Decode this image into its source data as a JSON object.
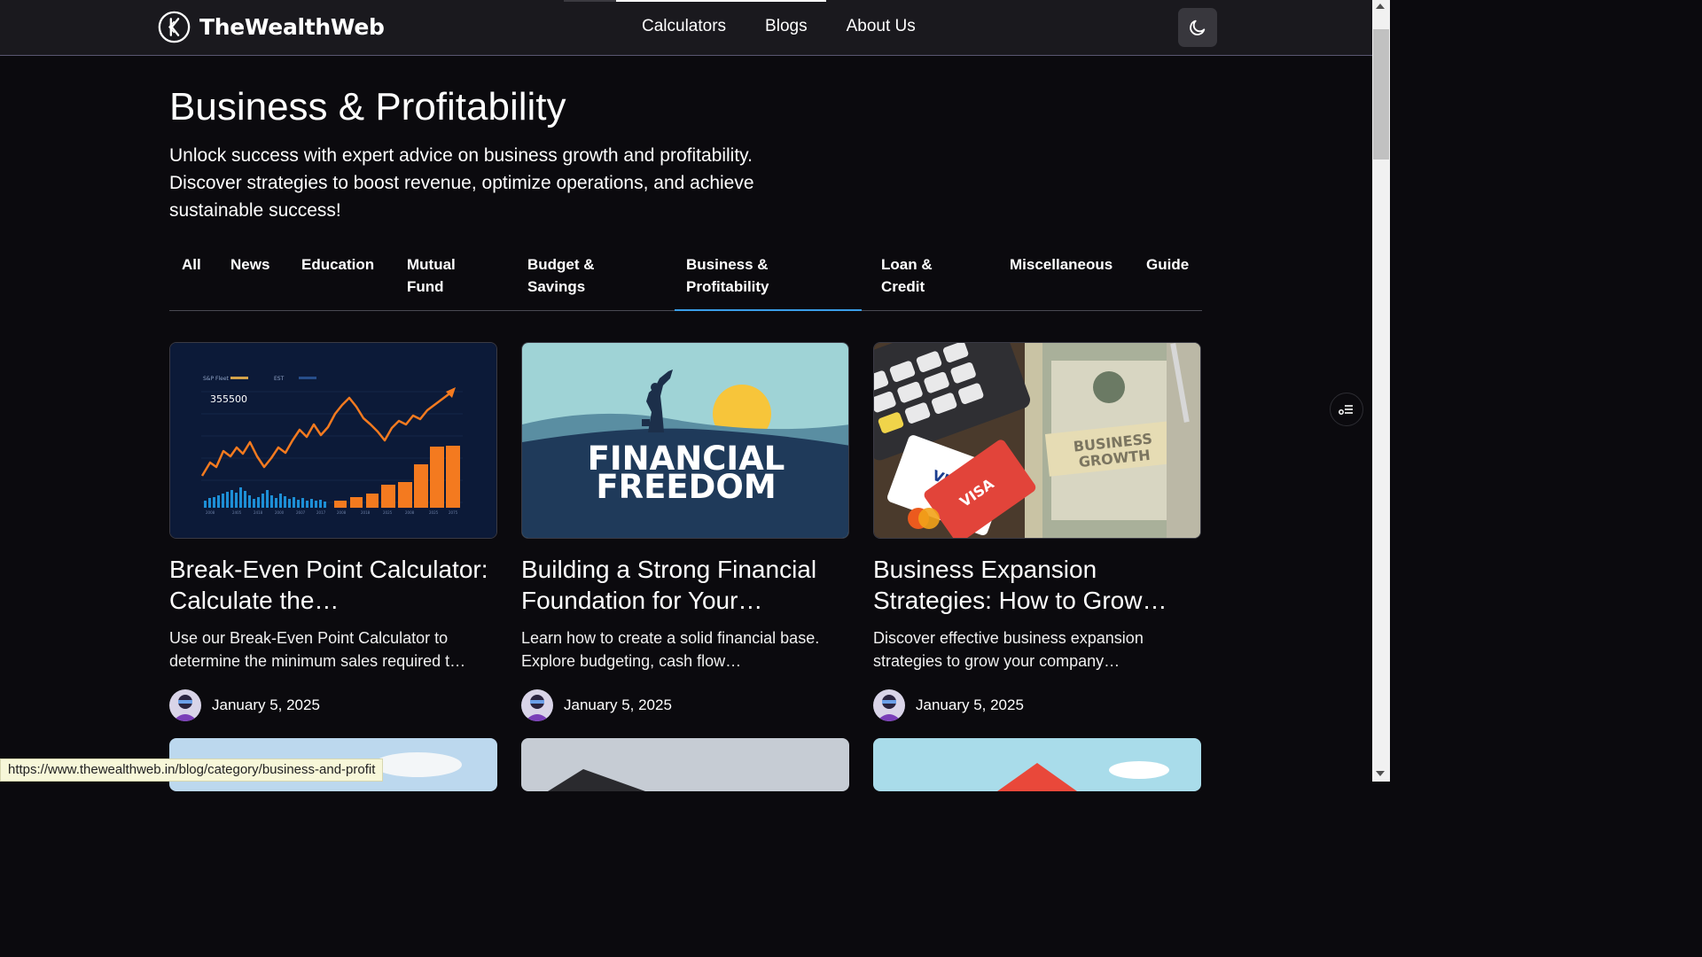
{
  "brand": {
    "name": "TheWealthWeb",
    "logo_icon": "wealthweb-logo-icon"
  },
  "nav": {
    "items": [
      "Calculators",
      "Blogs",
      "About Us"
    ]
  },
  "theme_toggle": {
    "icon": "moon-icon"
  },
  "hero": {
    "title": "Business & Profitability",
    "description": "Unlock success with expert advice on business growth and profitability. Discover strategies to boost revenue, optimize operations, and achieve sustainable success!"
  },
  "tabs": {
    "items": [
      "All",
      "News",
      "Education",
      "Mutual Fund",
      "Budget & Savings",
      "Business & Profitability",
      "Loan & Credit",
      "Miscellaneous",
      "Guide"
    ],
    "active": "Business & Profitability"
  },
  "cards": [
    {
      "image_text": "355500",
      "image_legend": [
        "S&P Fleet",
        "EST"
      ],
      "title": "Break-Even Point Calculator: Calculate the…",
      "excerpt": "Use our Break-Even Point Calculator to determine the minimum sales required t…",
      "date": "January 5, 2025"
    },
    {
      "image_text_1": "FINANCIAL",
      "image_text_2": "FREEDOM",
      "title": "Building a Strong Financial Foundation for Your…",
      "excerpt": "Learn how to create a solid financial base. Explore budgeting, cash flow…",
      "date": "January 5, 2025"
    },
    {
      "image_text_1": "BUSINESS",
      "image_text_2": "GROWTH",
      "image_card_1": "VISA",
      "image_card_2": "VISA",
      "title": "Business Expansion Strategies: How to Grow…",
      "excerpt": "Discover effective business expansion strategies to grow your company…",
      "date": "January 5, 2025"
    }
  ],
  "status_bar": {
    "url": "https://www.thewealthweb.in/blog/category/business-and-profit"
  },
  "colors": {
    "background": "#0b0a0e",
    "header": "#1a191e",
    "accent": "#3a9ee8"
  }
}
